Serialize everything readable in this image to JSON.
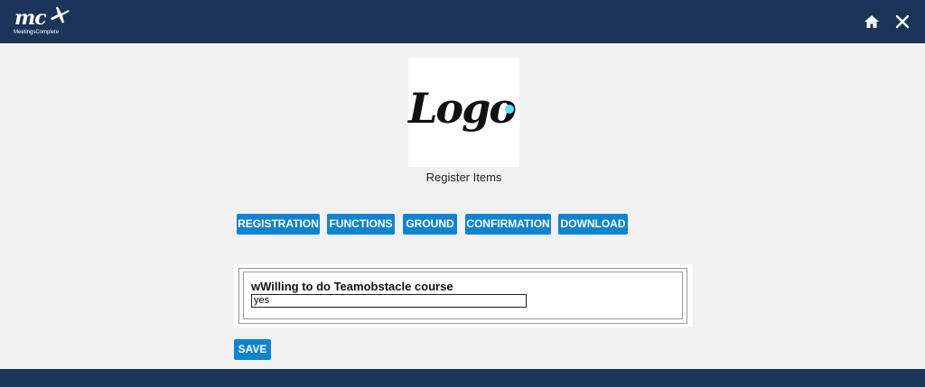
{
  "header": {
    "brand_short": "mc",
    "brand_full": "MeetingsComplete",
    "home_icon": "home-icon",
    "close_icon": "close-icon"
  },
  "logo": {
    "text": "Logo"
  },
  "page_title": "Register Items",
  "tabs": [
    {
      "label": "REGISTRATION"
    },
    {
      "label": "FUNCTIONS"
    },
    {
      "label": "GROUND"
    },
    {
      "label": "CONFIRMATION"
    },
    {
      "label": "DOWNLOAD"
    }
  ],
  "form": {
    "question_label": "wWilling to do Teamobstacle course",
    "answer_value": "yes"
  },
  "actions": {
    "save_label": "SAVE"
  },
  "colors": {
    "header_bg": "#1c3458",
    "button_bg": "#0e84d0",
    "page_bg": "#f1f1f1",
    "logo_dot": "#5be3f1"
  }
}
